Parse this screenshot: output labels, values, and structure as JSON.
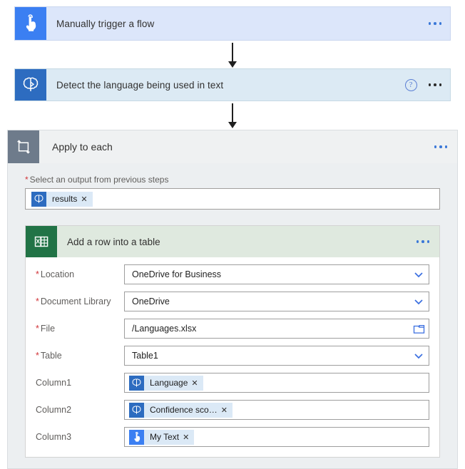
{
  "flow": {
    "trigger": {
      "title": "Manually trigger a flow",
      "icon": "tap-hand-icon",
      "accent": "#3b7ff2",
      "background": "#dce6fa",
      "menu": "more-commands"
    },
    "action_detect": {
      "title": "Detect the language being used in text",
      "icon": "brain-icon",
      "accent": "#2d6cc0",
      "background": "#dceaf4",
      "help": "?",
      "menu": "more-commands"
    },
    "loop": {
      "title": "Apply to each",
      "icon": "loop-icon",
      "accent": "#6e7b8b",
      "background": "#eceff1",
      "menu": "more-commands",
      "select_field": {
        "label": "Select an output from previous steps",
        "required": true,
        "required_marker": "*",
        "token": {
          "label": "results",
          "icon": "brain-icon",
          "remove": "✕"
        }
      },
      "excel_action": {
        "title": "Add a row into a table",
        "icon": "excel-icon",
        "accent": "#217346",
        "background": "#dfe9df",
        "menu": "more-commands",
        "fields": [
          {
            "label": "Location",
            "required": true,
            "required_marker": "*",
            "type": "dropdown",
            "value": "OneDrive for Business",
            "trailing_icon": "chevron-down-icon"
          },
          {
            "label": "Document Library",
            "required": true,
            "required_marker": "*",
            "type": "dropdown",
            "value": "OneDrive",
            "trailing_icon": "chevron-down-icon"
          },
          {
            "label": "File",
            "required": true,
            "required_marker": "*",
            "type": "file-picker",
            "value": "/Languages.xlsx",
            "trailing_icon": "folder-icon"
          },
          {
            "label": "Table",
            "required": true,
            "required_marker": "*",
            "type": "dropdown",
            "value": "Table1",
            "trailing_icon": "chevron-down-icon"
          },
          {
            "label": "Column1",
            "required": false,
            "required_marker": "",
            "type": "token",
            "token": {
              "label": "Language",
              "icon": "brain-icon",
              "remove": "✕"
            }
          },
          {
            "label": "Column2",
            "required": false,
            "required_marker": "",
            "type": "token",
            "token": {
              "label": "Confidence sco…",
              "icon": "brain-icon",
              "remove": "✕"
            }
          },
          {
            "label": "Column3",
            "required": false,
            "required_marker": "",
            "type": "token",
            "token": {
              "label": "My Text",
              "icon": "tap-hand-icon",
              "remove": "✕"
            }
          }
        ]
      }
    }
  }
}
